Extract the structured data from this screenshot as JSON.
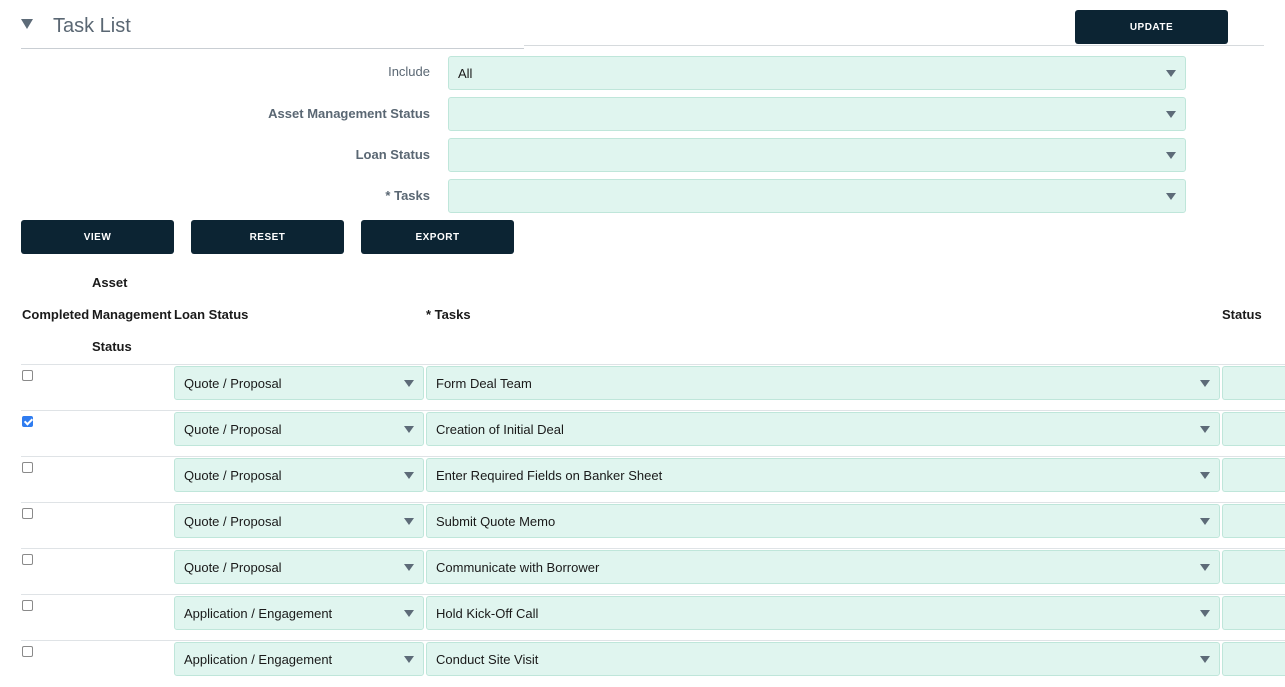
{
  "header": {
    "title": "Task List",
    "update_label": "UPDATE"
  },
  "filters": {
    "include": {
      "label": "Include",
      "value": "All"
    },
    "asset_management_status": {
      "label": "Asset Management Status",
      "value": ""
    },
    "loan_status": {
      "label": "Loan Status",
      "value": ""
    },
    "tasks": {
      "label": "* Tasks",
      "value": ""
    }
  },
  "actions": {
    "view_label": "VIEW",
    "reset_label": "RESET",
    "export_label": "EXPORT"
  },
  "table": {
    "headers": {
      "completed": "Completed",
      "asset_management_status": [
        "Asset",
        "Management",
        "Status"
      ],
      "loan_status": "Loan Status",
      "tasks": "* Tasks",
      "status": "Status"
    },
    "rows": [
      {
        "completed": false,
        "loan_status": "Quote / Proposal",
        "task": "Form Deal Team"
      },
      {
        "completed": true,
        "loan_status": "Quote / Proposal",
        "task": "Creation of Initial Deal"
      },
      {
        "completed": false,
        "loan_status": "Quote / Proposal",
        "task": "Enter Required Fields on Banker Sheet"
      },
      {
        "completed": false,
        "loan_status": "Quote / Proposal",
        "task": "Submit Quote Memo"
      },
      {
        "completed": false,
        "loan_status": "Quote / Proposal",
        "task": "Communicate with Borrower"
      },
      {
        "completed": false,
        "loan_status": "Application / Engagement",
        "task": "Hold Kick-Off Call"
      },
      {
        "completed": false,
        "loan_status": "Application / Engagement",
        "task": "Conduct Site Visit"
      }
    ]
  }
}
